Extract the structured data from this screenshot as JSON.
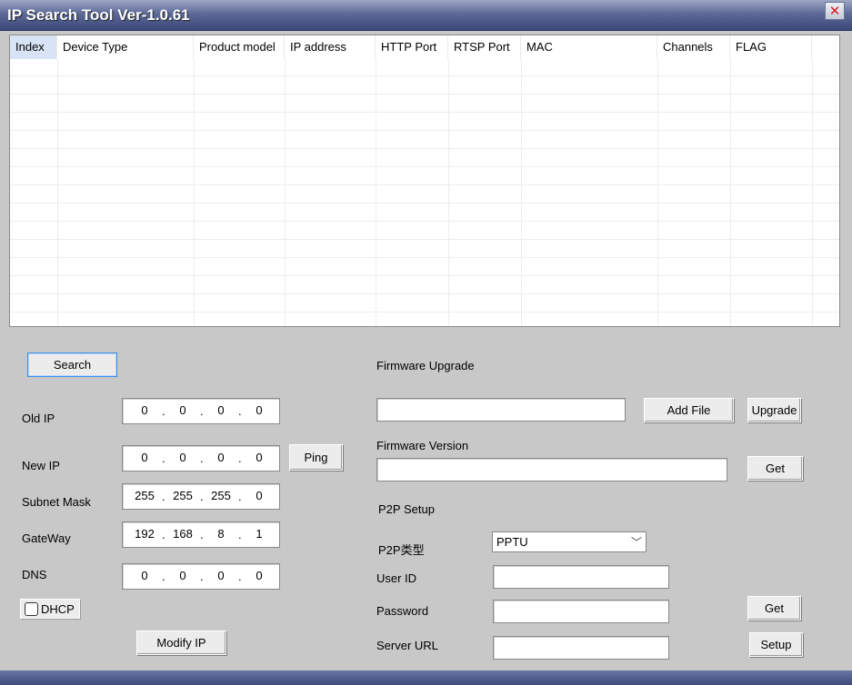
{
  "window": {
    "title": "IP Search Tool Ver-1.0.61",
    "close_glyph": "✕"
  },
  "grid": {
    "columns": [
      "Index",
      "Device Type",
      "Product model",
      "IP address",
      "HTTP Port",
      "RTSP Port",
      "MAC",
      "Channels",
      "FLAG"
    ]
  },
  "network": {
    "search_label": "Search",
    "old_ip_label": "Old IP",
    "old_ip": [
      "0",
      "0",
      "0",
      "0"
    ],
    "new_ip_label": "New IP",
    "new_ip": [
      "0",
      "0",
      "0",
      "0"
    ],
    "ping_label": "Ping",
    "subnet_label": "Subnet Mask",
    "subnet": [
      "255",
      "255",
      "255",
      "0"
    ],
    "gateway_label": "GateWay",
    "gateway": [
      "192",
      "168",
      "8",
      "1"
    ],
    "dns_label": "DNS",
    "dns": [
      "0",
      "0",
      "0",
      "0"
    ],
    "dot": ".",
    "dhcp_label": "DHCP",
    "dhcp_checked": false,
    "modify_label": "Modify IP"
  },
  "firmware": {
    "upgrade_heading": "Firmware Upgrade",
    "file_path": "",
    "add_file_label": "Add File",
    "upgrade_label": "Upgrade",
    "version_heading": "Firmware Version",
    "version_value": "",
    "get_label": "Get"
  },
  "p2p": {
    "heading": "P2P Setup",
    "type_label": "P2P类型",
    "type_value": "PPTU",
    "chevron": "﹀",
    "user_id_label": "User ID",
    "user_id": "",
    "password_label": "Password",
    "password": "",
    "get_label": "Get",
    "server_url_label": "Server URL",
    "server_url": "",
    "setup_label": "Setup"
  }
}
